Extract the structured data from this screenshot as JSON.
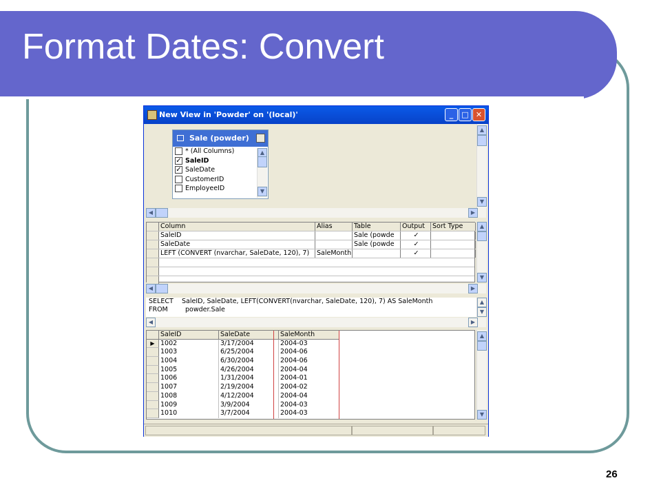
{
  "slide": {
    "title": "Format Dates: Convert",
    "page_number": "26"
  },
  "window": {
    "title": "New View in 'Powder' on '(local)'",
    "minimize_icon": "minimize-icon",
    "maximize_icon": "maximize-icon",
    "close_icon": "close-icon"
  },
  "diagram": {
    "table_name": "Sale (powder)",
    "columns": [
      {
        "label": "* (All Columns)",
        "checked": false
      },
      {
        "label": "SaleID",
        "checked": true
      },
      {
        "label": "SaleDate",
        "checked": true
      },
      {
        "label": "CustomerID",
        "checked": false
      },
      {
        "label": "EmployeeID",
        "checked": false
      }
    ]
  },
  "grid": {
    "headers": {
      "column": "Column",
      "alias": "Alias",
      "table": "Table",
      "output": "Output",
      "sort_type": "Sort Type"
    },
    "rows": [
      {
        "column": "SaleID",
        "alias": "",
        "table": "Sale (powde",
        "output": "✓"
      },
      {
        "column": "SaleDate",
        "alias": "",
        "table": "Sale (powde",
        "output": "✓"
      },
      {
        "column": "LEFT (CONVERT (nvarchar, SaleDate, 120), 7)",
        "alias": "SaleMonth",
        "table": "",
        "output": "✓"
      }
    ]
  },
  "sql": {
    "line1_keyword": "SELECT",
    "line1_text": "SaleID, SaleDate, LEFT(CONVERT(nvarchar, SaleDate, 120), 7) AS SaleMonth",
    "line2_keyword": "FROM",
    "line2_text": "powder.Sale"
  },
  "results": {
    "headers": [
      "SaleID",
      "SaleDate",
      "SaleMonth"
    ],
    "rows": [
      [
        "1002",
        "3/17/2004",
        "2004-03"
      ],
      [
        "1003",
        "6/25/2004",
        "2004-06"
      ],
      [
        "1004",
        "6/30/2004",
        "2004-06"
      ],
      [
        "1005",
        "4/26/2004",
        "2004-04"
      ],
      [
        "1006",
        "1/31/2004",
        "2004-01"
      ],
      [
        "1007",
        "2/19/2004",
        "2004-02"
      ],
      [
        "1008",
        "4/12/2004",
        "2004-04"
      ],
      [
        "1009",
        "3/9/2004",
        "2004-03"
      ],
      [
        "1010",
        "3/7/2004",
        "2004-03"
      ]
    ]
  },
  "colors": {
    "banner": "#6466cc",
    "frame": "#6e9a9b",
    "titlebar": "#0a5ae8",
    "highlight": "#d04040"
  }
}
